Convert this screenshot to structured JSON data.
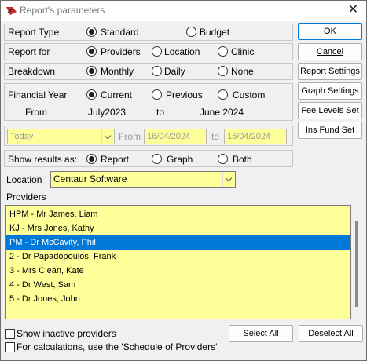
{
  "window": {
    "title": "Report's parameters",
    "close_glyph": "✕"
  },
  "report_type": {
    "label": "Report Type",
    "options": [
      "Standard",
      "Budget"
    ],
    "selected": "Standard"
  },
  "report_for": {
    "label": "Report for",
    "options": [
      "Providers",
      "Location",
      "Clinic"
    ],
    "selected": "Providers"
  },
  "breakdown": {
    "label": "Breakdown",
    "options": [
      "Monthly",
      "Daily",
      "None"
    ],
    "selected": "Monthly"
  },
  "financial_year": {
    "label": "Financial Year",
    "options": [
      "Current",
      "Previous",
      "Custom"
    ],
    "selected": "Current",
    "from_label": "From",
    "from_value": "July2023",
    "to_label": "to",
    "to_value": "June 2024"
  },
  "date_range": {
    "period": "Today",
    "from_label": "From",
    "from_value": "16/04/2024",
    "to_label": "to",
    "to_value": "16/04/2024"
  },
  "show_results": {
    "label": "Show results as:",
    "options": [
      "Report",
      "Graph",
      "Both"
    ],
    "selected": "Report"
  },
  "location": {
    "label": "Location",
    "value": "Centaur Software"
  },
  "providers": {
    "label": "Providers",
    "items": [
      "HPM - Mr James, Liam",
      "KJ - Mrs Jones, Kathy",
      "PM - Dr McCavity, Phil",
      "2 - Dr Papadopoulos, Frank",
      "3 - Mrs Clean, Kate",
      "4 - Dr West, Sam",
      "5 - Dr Jones, John"
    ],
    "selected_index": 2
  },
  "checkboxes": {
    "show_inactive": "Show inactive providers",
    "schedule": "For calculations, use the 'Schedule of Providers'"
  },
  "buttons": {
    "ok": "OK",
    "cancel": "Cancel",
    "report_settings": "Report Settings",
    "graph_settings": "Graph Settings",
    "fee_levels_set": "Fee Levels Set",
    "ins_fund_set": "Ins Fund Set",
    "select_all": "Select All",
    "deselect_all": "Deselect All"
  },
  "colors": {
    "field_bg": "#ffff99",
    "selection": "#0078d7",
    "brand_icon": "#c62828"
  }
}
